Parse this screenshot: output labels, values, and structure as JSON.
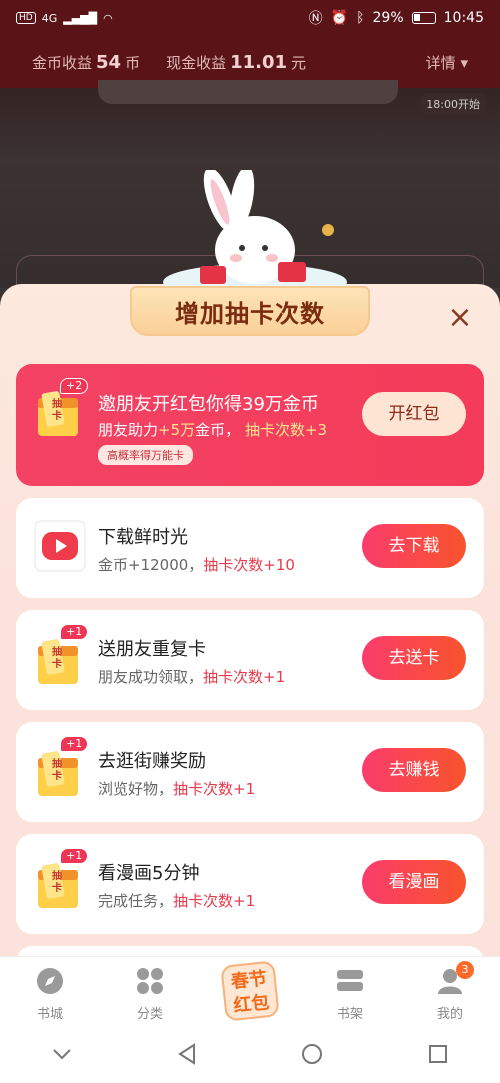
{
  "status": {
    "network": "4G",
    "battery": "29%",
    "time": "10:45"
  },
  "earnings": {
    "coin_label": "金币收益",
    "coin_value": "54",
    "coin_unit": "币",
    "cash_label": "现金收益",
    "cash_value": "11.01",
    "cash_unit": "元",
    "detail": "详情"
  },
  "bg": {
    "start_badge": "18:00开始"
  },
  "sheet": {
    "title": "增加抽卡次数"
  },
  "tasks": [
    {
      "title": "邀朋友开红包你得39万金币",
      "sub_a": "朋友助力",
      "sub_b": "+5万",
      "sub_c": "金币，",
      "sub_d": "抽卡次数+3",
      "tag": "高概率得万能卡",
      "button": "开红包",
      "plus": "+2"
    },
    {
      "title": "下载鲜时光",
      "sub_a": "金币+12000，",
      "sub_d": "抽卡次数+10",
      "button": "去下载"
    },
    {
      "title": "送朋友重复卡",
      "sub_a": "朋友成功领取，",
      "sub_d": "抽卡次数+1",
      "button": "去送卡",
      "plus": "+1"
    },
    {
      "title": "去逛街赚奖励",
      "sub_a": "浏览好物，",
      "sub_d": "抽卡次数+1",
      "button": "去赚钱",
      "plus": "+1"
    },
    {
      "title": "看漫画5分钟",
      "sub_a": "完成任务，",
      "sub_d": "抽卡次数+1",
      "button": "看漫画",
      "plus": "+1"
    }
  ],
  "icon_char": {
    "a": "抽",
    "b": "卡"
  },
  "tabs": [
    {
      "label": "书城",
      "icon": "compass-icon"
    },
    {
      "label": "分类",
      "icon": "grid-icon"
    },
    {
      "label": "春节红包",
      "line1": "春节",
      "line2": "红包",
      "icon": "festival-icon"
    },
    {
      "label": "书架",
      "icon": "shelf-icon"
    },
    {
      "label": "我的",
      "icon": "user-icon",
      "badge": "3"
    }
  ],
  "colors": {
    "accent": "#f34264",
    "button": "#fb3c6c",
    "tab_active": "#f26a1b"
  }
}
